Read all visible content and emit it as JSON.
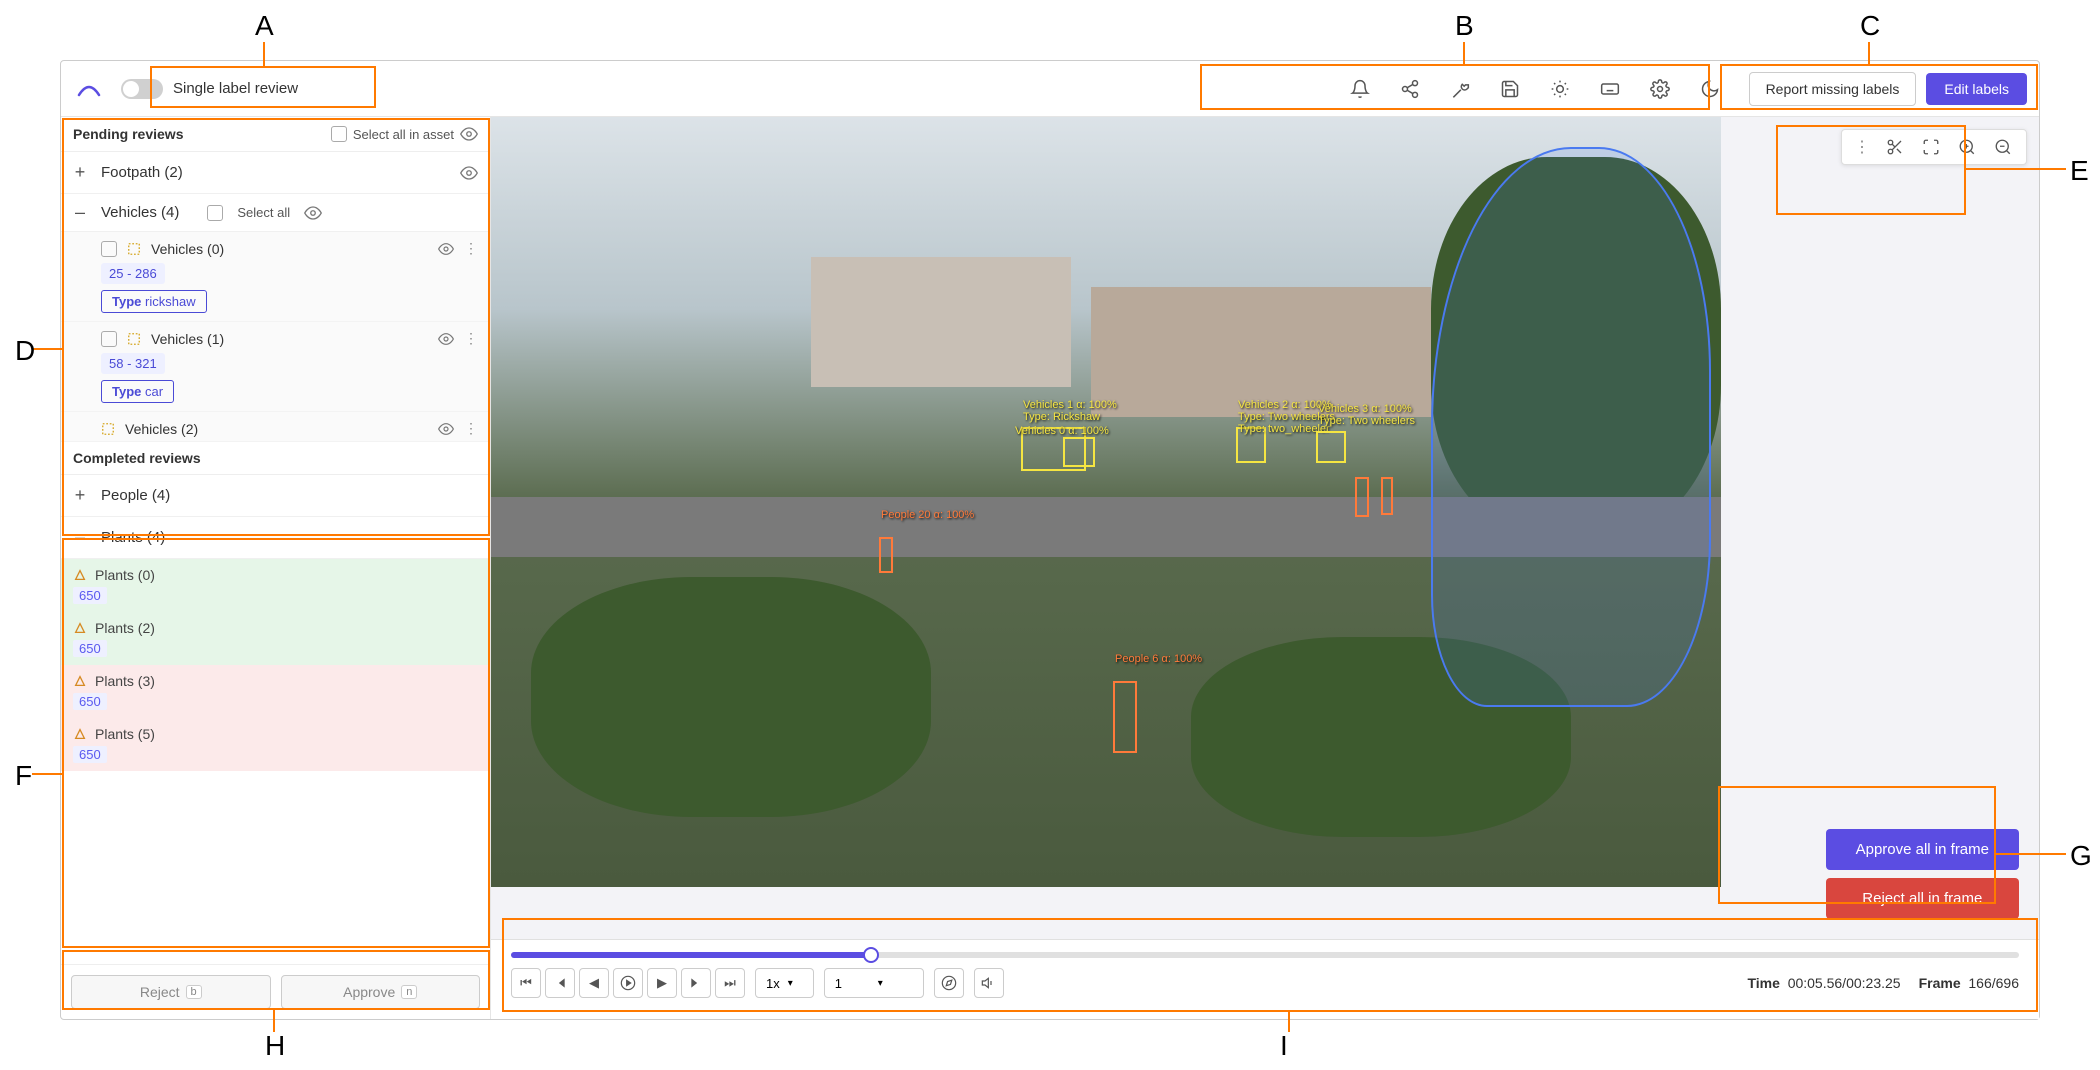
{
  "topbar": {
    "single_label_review": "Single label review",
    "report_missing": "Report missing labels",
    "edit_labels": "Edit labels"
  },
  "sidebar": {
    "pending_header": "Pending reviews",
    "select_all_asset": "Select all in asset",
    "select_all": "Select all",
    "footpath": {
      "label": "Footpath (2)"
    },
    "vehicles_group": {
      "label": "Vehicles (4)"
    },
    "vehicles": [
      {
        "name": "Vehicles (0)",
        "range": "25  -  286",
        "type_key": "Type",
        "type_val": "rickshaw"
      },
      {
        "name": "Vehicles (1)",
        "range": "58  -  321",
        "type_key": "Type",
        "type_val": "car"
      },
      {
        "name": "Vehicles (2)",
        "range": "",
        "type_key": "",
        "type_val": ""
      }
    ],
    "completed_header": "Completed reviews",
    "people_group": {
      "label": "People (4)"
    },
    "plants_group": {
      "label": "Plants (4)"
    },
    "plants": [
      {
        "name": "Plants (0)",
        "val": "650",
        "status": "green"
      },
      {
        "name": "Plants (2)",
        "val": "650",
        "status": "green"
      },
      {
        "name": "Plants (3)",
        "val": "650",
        "status": "red"
      },
      {
        "name": "Plants (5)",
        "val": "650",
        "status": "red"
      }
    ],
    "reject_label": "Reject",
    "reject_key": "b",
    "approve_label": "Approve",
    "approve_key": "n"
  },
  "annotations": {
    "veh1": "Vehicles 1 α: 100%",
    "veh1b": "Type: Rickshaw",
    "veh0": "Vehicles 0 α: 100%",
    "veh2": "Vehicles 2 α: 100%",
    "veh2b": "Type: Two wheelers",
    "veh2c": "Type: two_wheeler",
    "veh3": "Vehicles 3 α: 100%",
    "veh3b": "Type: Two wheelers",
    "people20": "People 20 α: 100%",
    "people6": "People 6 α: 100%"
  },
  "frame_actions": {
    "approve": "Approve all in frame",
    "reject": "Reject all in frame"
  },
  "timeline": {
    "speed": "1x",
    "frame_input": "1",
    "time_label": "Time",
    "time_value": "00:05.56/00:23.25",
    "frame_label": "Frame",
    "frame_value": "166/696",
    "progress_pct": 23.85
  },
  "callouts": {
    "A": "A",
    "B": "B",
    "C": "C",
    "D": "D",
    "E": "E",
    "F": "F",
    "G": "G",
    "H": "H",
    "I": "I"
  }
}
